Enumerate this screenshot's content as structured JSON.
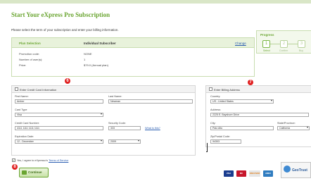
{
  "page": {
    "title": "Start Your eXpress Pro Subscription",
    "intro": "Please select the term of your subscription and enter your billing information."
  },
  "progress": {
    "title": "Progress",
    "steps": [
      {
        "number": "1",
        "label": "Select"
      },
      {
        "number": "2",
        "label": "Confirm"
      },
      {
        "number": "3",
        "label": "Buy"
      }
    ]
  },
  "plan": {
    "heading": "Plan Selection",
    "name": "Individual Subscriber",
    "change_link": "Change",
    "rows": [
      {
        "label": "Promotion code:",
        "value": "NONE"
      },
      {
        "label": "Number of user(s):",
        "value": "1"
      },
      {
        "label": "Price:",
        "value": "$79.0 (Annual plan)"
      }
    ]
  },
  "credit_card": {
    "title": "Enter Credit Card Information",
    "badge": "6",
    "first_name_label": "First Name:",
    "first_name_value": "Amber",
    "last_name_label": "Last Name:",
    "last_name_value": "Newman",
    "card_type_label": "Card Type",
    "card_type_value": "Visa",
    "card_number_label": "Credit Card Number:",
    "card_number_value": "4111 1111 1111 1111",
    "security_code_label": "Security Code:",
    "security_code_value": "333",
    "whats_this_link": "What is this?",
    "expiration_label": "Expiration Date:",
    "expiration_month": "12 - December",
    "expiration_year": "2009"
  },
  "billing": {
    "title": "Enter Billing Address",
    "badge": "7",
    "country_label": "Country:",
    "country_value": "US - United States",
    "address_label": "Address:",
    "address_value": "2225 E. Bayshore Drive",
    "city_label": "City:",
    "city_value": "Palo Alto",
    "state_label": "State/Province:",
    "state_value": "California",
    "zip_label": "Zip/Postal Code:",
    "zip_value": "94303"
  },
  "agreement": {
    "checkmark": "✓",
    "text": "Yes, I agree to eXpresso's",
    "link": "Terms of Service"
  },
  "continue": {
    "badge": "8",
    "label": "Continue"
  },
  "payment": {
    "cards": [
      "VISA",
      "MC",
      "DISCOVER",
      "AMEX"
    ],
    "seal_text": "GeoTrust"
  },
  "colors": {
    "brand_green": "#6aa531",
    "link_blue": "#2a5db0",
    "badge_red": "#e02020"
  }
}
